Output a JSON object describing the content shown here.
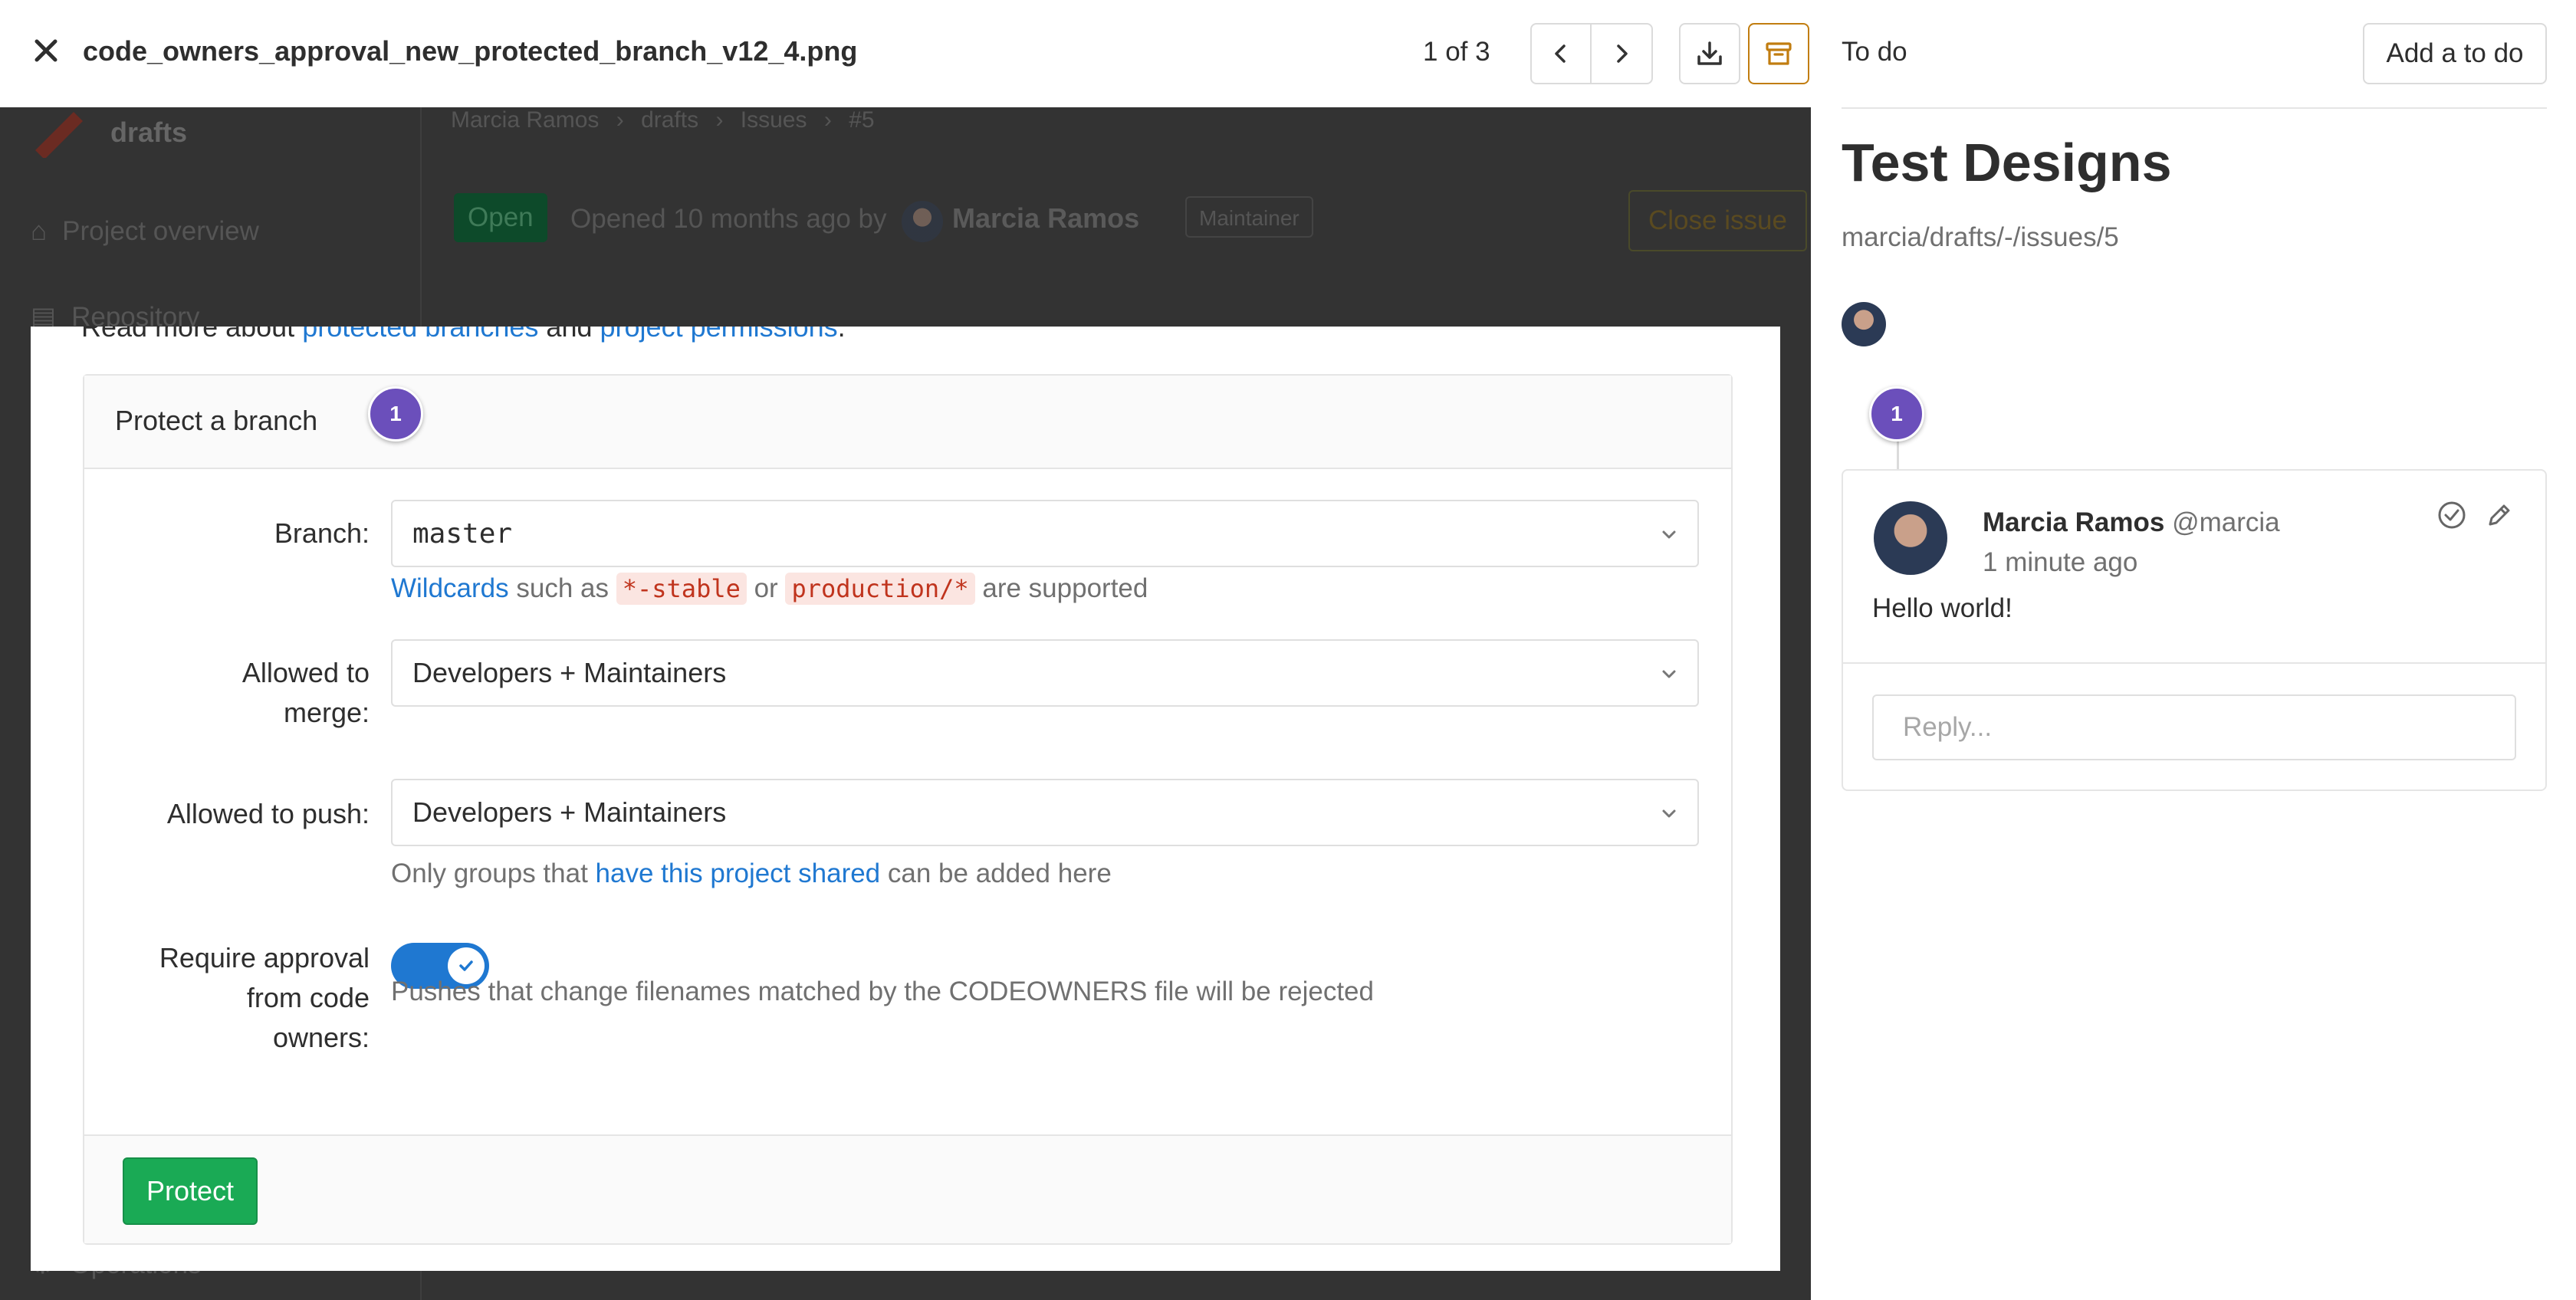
{
  "viewer": {
    "filename": "code_owners_approval_new_protected_branch_v12_4.png",
    "page_count": "1 of 3"
  },
  "background_page": {
    "project_name": "drafts",
    "breadcrumb": [
      "Marcia Ramos",
      "drafts",
      "Issues",
      "#5"
    ],
    "status_badge": "Open",
    "opened_text": "Opened 10 months ago by",
    "author_name": "Marcia Ramos",
    "role_badge": "Maintainer",
    "close_button": "Close issue",
    "nav_items": [
      "Project overview",
      "Repository",
      "Operations"
    ]
  },
  "design": {
    "readmore_prefix": "Read more about",
    "readmore_link1": "protected branches",
    "readmore_and": "and",
    "readmore_link2": "project permissions",
    "readmore_suffix": ".",
    "panel_title": "Protect a branch",
    "branch_label": "Branch:",
    "branch_value": "master",
    "wildcards_link": "Wildcards",
    "wildcards_text1": "such as",
    "wildcards_code1": "*-stable",
    "wildcards_or": "or",
    "wildcards_code2": "production/*",
    "wildcards_text2": "are supported",
    "merge_label_line1": "Allowed to",
    "merge_label_line2": "merge:",
    "merge_value": "Developers + Maintainers",
    "push_label": "Allowed to push:",
    "push_value": "Developers + Maintainers",
    "push_help_prefix": "Only groups that",
    "push_help_link": "have this project shared",
    "push_help_suffix": "can be added here",
    "codeowners_label_line1": "Require approval",
    "codeowners_label_line2": "from code",
    "codeowners_label_line3": "owners:",
    "codeowners_enabled": true,
    "codeowners_help": "Pushes that change filenames matched by the CODEOWNERS file will be rejected",
    "protect_button": "Protect",
    "pin_number": "1"
  },
  "sidebar": {
    "todo_label": "To do",
    "todo_button": "Add a to do",
    "design_title": "Test Designs",
    "issue_path": "marcia/drafts/-/issues/5",
    "thread_pin": "1",
    "note": {
      "author": "Marcia Ramos",
      "handle": "@marcia",
      "time": "1 minute ago",
      "body": "Hello world!"
    },
    "reply_placeholder": "Reply..."
  },
  "colors": {
    "pin_purple": "#6b4fbb",
    "link_blue": "#1f78d1",
    "protect_green": "#1aaa55",
    "archive_orange": "#c17d10",
    "overlay_dark": "#333333"
  }
}
